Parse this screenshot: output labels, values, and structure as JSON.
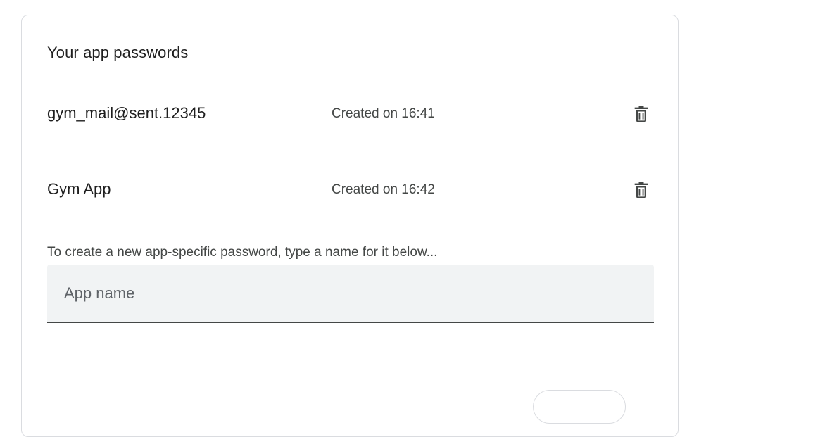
{
  "card": {
    "title": "Your app passwords"
  },
  "passwords": [
    {
      "name": "gym_mail@sent.12345",
      "created": "Created on 16:41",
      "delete_icon": "trash-icon"
    },
    {
      "name": "Gym App",
      "created": "Created on 16:42",
      "delete_icon": "trash-icon"
    }
  ],
  "create": {
    "hint": "To create a new app-specific password, type a name for it below...",
    "input_placeholder": "App name",
    "input_value": "",
    "button_label": ""
  },
  "colors": {
    "text_primary": "#1f1f1f",
    "text_secondary": "#444746",
    "field_bg": "#f1f3f4",
    "border": "#dadce0"
  }
}
